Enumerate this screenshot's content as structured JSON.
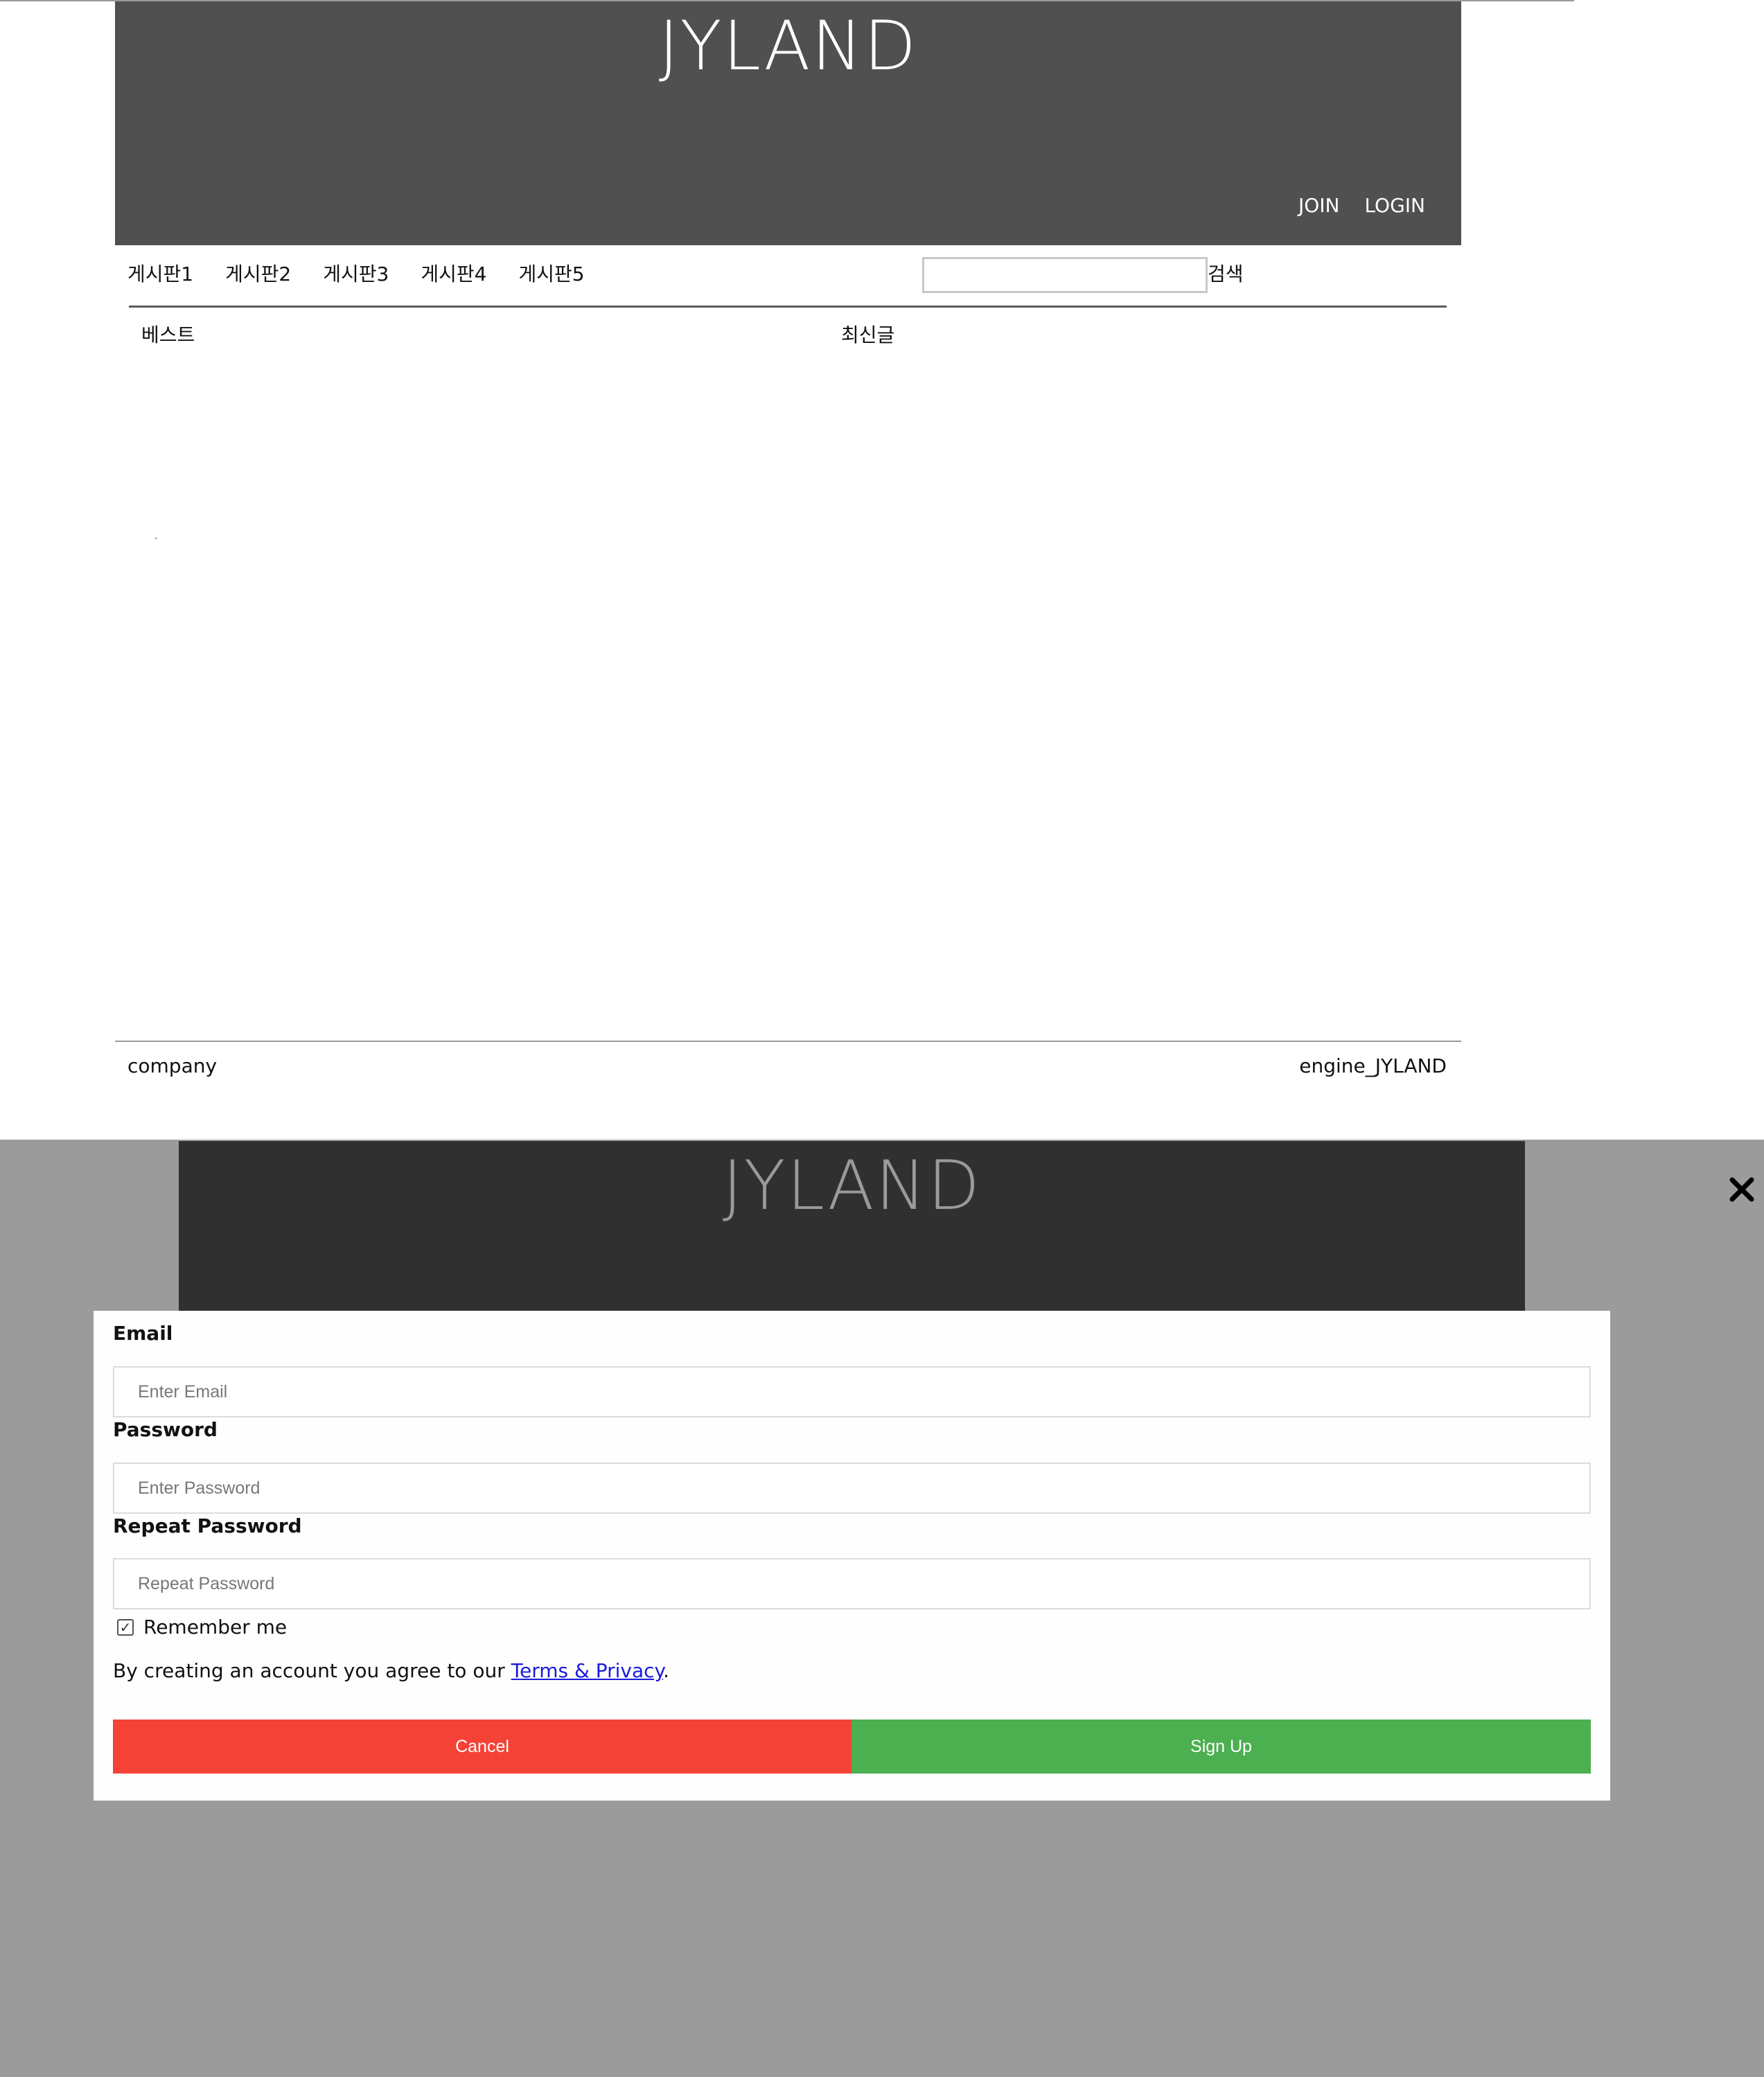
{
  "site": {
    "logo": "JYLAND",
    "header_links": {
      "join": "JOIN",
      "login": "LOGIN"
    }
  },
  "nav": {
    "items": [
      "게시판1",
      "게시판2",
      "게시판3",
      "게시판4",
      "게시판5"
    ],
    "search_button": "검색",
    "search_value": ""
  },
  "sections": {
    "best": "베스트",
    "recent": "최신글"
  },
  "footer": {
    "left": "company",
    "right": "engine_JYLAND"
  },
  "signup_modal": {
    "email_label": "Email",
    "email_placeholder": "Enter Email",
    "password_label": "Password",
    "password_placeholder": "Enter Password",
    "repeat_label": "Repeat Password",
    "repeat_placeholder": "Repeat Password",
    "remember_label": "Remember me",
    "remember_checked": true,
    "terms_prefix": "By creating an account you agree to our ",
    "terms_link": "Terms & Privacy",
    "terms_suffix": ".",
    "cancel_label": "Cancel",
    "signup_label": "Sign Up",
    "close_icon": "close-icon"
  },
  "colors": {
    "header_bg": "#505050",
    "overlay_bg": "#9b9b9b",
    "cancel": "#f44336",
    "signup": "#4caf50",
    "link": "#1a1adc"
  }
}
